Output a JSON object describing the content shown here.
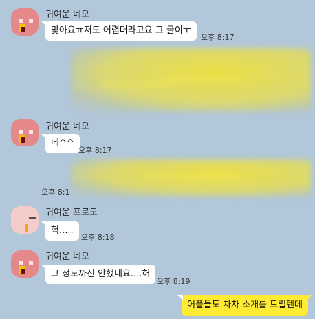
{
  "messages": [
    {
      "sender": "귀여운 네오",
      "text": "맞아요ㅠ저도 어렵더라고요 그 글이ㅜ",
      "time": "오후 8:17"
    },
    {
      "sender": "귀여운 네오",
      "text": "네^^",
      "time": "오후 8:17"
    },
    {
      "time_partial": "오후 8:1"
    },
    {
      "sender": "귀여운 프로도",
      "text": "헉.....",
      "time": "오후 8:18"
    },
    {
      "sender": "귀여운 네오",
      "text": "그 정도까진 안했네요....허",
      "time": "오후 8:19"
    },
    {
      "text": "어플들도 차차 소개를 드릴텐데"
    }
  ],
  "colors": {
    "background": "#b2c7d9",
    "my_bubble": "#ffeb33",
    "their_bubble": "#ffffff"
  },
  "icons": {
    "neo_avatar": "neo-avatar-icon",
    "frodo_avatar": "frodo-avatar-icon"
  }
}
